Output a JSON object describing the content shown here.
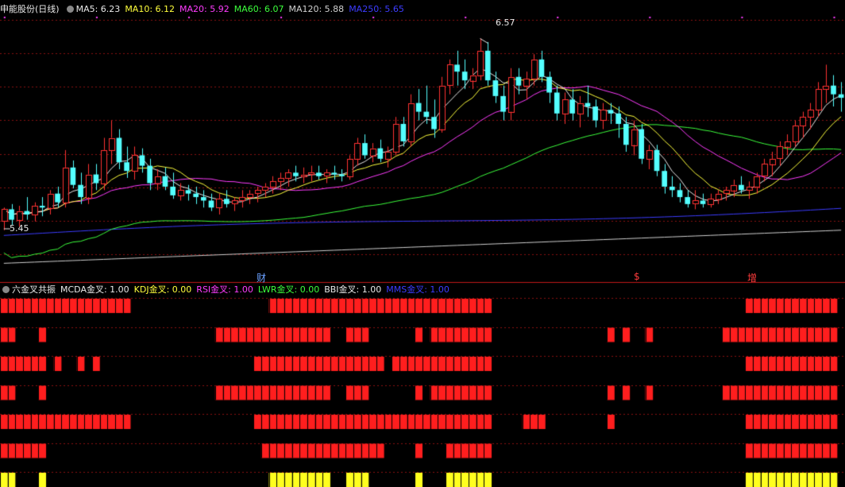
{
  "top_panel": {
    "title": "申能股份(日线)",
    "indicators": [
      {
        "label": "MA5: 6.23",
        "color": "#e8e8e8"
      },
      {
        "label": "MA10: 6.12",
        "color": "#ffff3c"
      },
      {
        "label": "MA20: 5.92",
        "color": "#ff3cff"
      },
      {
        "label": "MA60: 6.07",
        "color": "#3cff3c"
      },
      {
        "label": "MA120: 5.88",
        "color": "#d0d0d0"
      },
      {
        "label": "MA250: 5.65",
        "color": "#3c3cff"
      }
    ],
    "high_label": "6.57",
    "low_label": "5.45",
    "event_markers": [
      {
        "label": "财",
        "color": "#6aa0ff"
      },
      {
        "label": "$",
        "color": "#ff3c3c"
      },
      {
        "label": "增",
        "color": "#ff3c3c"
      }
    ]
  },
  "bottom_panel": {
    "title": "六金叉共振",
    "indicators": [
      {
        "label": "MCDA金叉: 1.00",
        "color": "#e8e8e8"
      },
      {
        "label": "KDJ金叉: 0.00",
        "color": "#ffff3c"
      },
      {
        "label": "RSI金叉: 1.00",
        "color": "#ff3cff"
      },
      {
        "label": "LWR金叉: 0.00",
        "color": "#3cff3c"
      },
      {
        "label": "BBI金叉: 1.00",
        "color": "#e8e8e8"
      },
      {
        "label": "MMS金叉: 1.00",
        "color": "#3c3cff"
      }
    ]
  },
  "chart_data": {
    "type": "candlestick",
    "price_range": [
      5.25,
      6.7
    ],
    "bars": 110,
    "candles": [
      [
        5.52,
        5.6,
        5.47,
        5.59
      ],
      [
        5.59,
        5.62,
        5.5,
        5.53
      ],
      [
        5.53,
        5.61,
        5.49,
        5.58
      ],
      [
        5.58,
        5.66,
        5.53,
        5.56
      ],
      [
        5.56,
        5.63,
        5.52,
        5.61
      ],
      [
        5.61,
        5.66,
        5.55,
        5.6
      ],
      [
        5.6,
        5.7,
        5.56,
        5.68
      ],
      [
        5.68,
        5.72,
        5.6,
        5.63
      ],
      [
        5.63,
        5.93,
        5.6,
        5.83
      ],
      [
        5.83,
        5.87,
        5.71,
        5.73
      ],
      [
        5.73,
        5.8,
        5.62,
        5.66
      ],
      [
        5.66,
        5.85,
        5.62,
        5.79
      ],
      [
        5.79,
        5.85,
        5.7,
        5.74
      ],
      [
        5.74,
        6.0,
        5.7,
        5.93
      ],
      [
        5.93,
        6.1,
        5.85,
        6.0
      ],
      [
        6.0,
        6.05,
        5.82,
        5.86
      ],
      [
        5.86,
        5.95,
        5.77,
        5.81
      ],
      [
        5.81,
        5.95,
        5.76,
        5.9
      ],
      [
        5.9,
        5.94,
        5.8,
        5.84
      ],
      [
        5.84,
        5.88,
        5.7,
        5.74
      ],
      [
        5.74,
        5.82,
        5.7,
        5.78
      ],
      [
        5.78,
        5.83,
        5.7,
        5.72
      ],
      [
        5.72,
        5.8,
        5.65,
        5.67
      ],
      [
        5.67,
        5.74,
        5.64,
        5.7
      ],
      [
        5.7,
        5.73,
        5.64,
        5.68
      ],
      [
        5.68,
        5.72,
        5.62,
        5.66
      ],
      [
        5.66,
        5.7,
        5.6,
        5.64
      ],
      [
        5.64,
        5.68,
        5.58,
        5.6
      ],
      [
        5.6,
        5.68,
        5.56,
        5.65
      ],
      [
        5.65,
        5.7,
        5.6,
        5.62
      ],
      [
        5.62,
        5.66,
        5.58,
        5.64
      ],
      [
        5.64,
        5.7,
        5.6,
        5.66
      ],
      [
        5.66,
        5.7,
        5.62,
        5.68
      ],
      [
        5.68,
        5.72,
        5.63,
        5.7
      ],
      [
        5.7,
        5.74,
        5.66,
        5.72
      ],
      [
        5.72,
        5.78,
        5.68,
        5.75
      ],
      [
        5.75,
        5.8,
        5.7,
        5.77
      ],
      [
        5.77,
        5.82,
        5.72,
        5.8
      ],
      [
        5.8,
        5.84,
        5.75,
        5.78
      ],
      [
        5.78,
        5.83,
        5.74,
        5.79
      ],
      [
        5.79,
        5.84,
        5.75,
        5.8
      ],
      [
        5.8,
        5.84,
        5.76,
        5.78
      ],
      [
        5.78,
        5.82,
        5.74,
        5.8
      ],
      [
        5.8,
        5.84,
        5.76,
        5.79
      ],
      [
        5.79,
        5.82,
        5.75,
        5.78
      ],
      [
        5.78,
        5.9,
        5.76,
        5.88
      ],
      [
        5.88,
        6.0,
        5.84,
        5.97
      ],
      [
        5.97,
        6.02,
        5.88,
        5.9
      ],
      [
        5.9,
        5.97,
        5.86,
        5.94
      ],
      [
        5.94,
        5.99,
        5.86,
        5.88
      ],
      [
        5.88,
        5.95,
        5.83,
        5.92
      ],
      [
        5.92,
        6.12,
        5.9,
        6.08
      ],
      [
        6.08,
        6.12,
        5.95,
        5.98
      ],
      [
        5.98,
        6.25,
        5.95,
        6.2
      ],
      [
        6.2,
        6.28,
        6.1,
        6.15
      ],
      [
        6.15,
        6.3,
        6.08,
        6.12
      ],
      [
        6.12,
        6.22,
        6.0,
        6.05
      ],
      [
        6.05,
        6.35,
        6.03,
        6.3
      ],
      [
        6.3,
        6.45,
        6.25,
        6.42
      ],
      [
        6.42,
        6.5,
        6.3,
        6.38
      ],
      [
        6.38,
        6.45,
        6.28,
        6.33
      ],
      [
        6.33,
        6.4,
        6.28,
        6.36
      ],
      [
        6.36,
        6.57,
        6.33,
        6.5
      ],
      [
        6.5,
        6.55,
        6.3,
        6.33
      ],
      [
        6.33,
        6.38,
        6.2,
        6.24
      ],
      [
        6.24,
        6.3,
        6.1,
        6.15
      ],
      [
        6.15,
        6.4,
        6.1,
        6.35
      ],
      [
        6.35,
        6.4,
        6.25,
        6.3
      ],
      [
        6.3,
        6.38,
        6.22,
        6.34
      ],
      [
        6.34,
        6.48,
        6.3,
        6.45
      ],
      [
        6.45,
        6.5,
        6.32,
        6.35
      ],
      [
        6.35,
        6.38,
        6.2,
        6.26
      ],
      [
        6.26,
        6.3,
        6.1,
        6.14
      ],
      [
        6.14,
        6.26,
        6.08,
        6.22
      ],
      [
        6.22,
        6.28,
        6.1,
        6.14
      ],
      [
        6.14,
        6.24,
        6.06,
        6.2
      ],
      [
        6.2,
        6.3,
        6.12,
        6.18
      ],
      [
        6.18,
        6.22,
        6.06,
        6.1
      ],
      [
        6.1,
        6.2,
        6.05,
        6.16
      ],
      [
        6.16,
        6.2,
        6.08,
        6.14
      ],
      [
        6.14,
        6.18,
        6.0,
        6.08
      ],
      [
        6.08,
        6.12,
        5.92,
        5.96
      ],
      [
        5.96,
        6.1,
        5.9,
        6.05
      ],
      [
        6.05,
        6.08,
        5.85,
        5.88
      ],
      [
        5.88,
        5.96,
        5.82,
        5.93
      ],
      [
        5.93,
        5.96,
        5.78,
        5.81
      ],
      [
        5.81,
        5.85,
        5.68,
        5.72
      ],
      [
        5.72,
        5.78,
        5.66,
        5.7
      ],
      [
        5.7,
        5.74,
        5.63,
        5.66
      ],
      [
        5.66,
        5.7,
        5.6,
        5.62
      ],
      [
        5.62,
        5.7,
        5.59,
        5.64
      ],
      [
        5.64,
        5.68,
        5.6,
        5.62
      ],
      [
        5.62,
        5.68,
        5.6,
        5.65
      ],
      [
        5.65,
        5.7,
        5.62,
        5.68
      ],
      [
        5.68,
        5.72,
        5.64,
        5.7
      ],
      [
        5.7,
        5.76,
        5.66,
        5.73
      ],
      [
        5.73,
        5.78,
        5.68,
        5.7
      ],
      [
        5.7,
        5.75,
        5.65,
        5.72
      ],
      [
        5.72,
        5.8,
        5.68,
        5.78
      ],
      [
        5.78,
        5.88,
        5.75,
        5.85
      ],
      [
        5.85,
        5.92,
        5.78,
        5.88
      ],
      [
        5.88,
        5.98,
        5.84,
        5.95
      ],
      [
        5.95,
        6.02,
        5.9,
        5.98
      ],
      [
        5.98,
        6.1,
        5.95,
        6.07
      ],
      [
        6.07,
        6.15,
        6.0,
        6.12
      ],
      [
        6.12,
        6.2,
        6.05,
        6.16
      ],
      [
        6.16,
        6.32,
        6.12,
        6.28
      ],
      [
        6.28,
        6.42,
        6.2,
        6.3
      ],
      [
        6.3,
        6.36,
        6.18,
        6.25
      ],
      [
        6.25,
        6.32,
        6.15,
        6.23
      ]
    ],
    "band_rows": [
      {
        "color": "#ff1e1e",
        "ranges": [
          [
            0,
            16
          ],
          [
            35,
            63
          ],
          [
            97,
            108
          ]
        ]
      },
      {
        "color": "#ff1e1e",
        "ranges": [
          [
            0,
            1
          ],
          [
            5,
            5
          ],
          [
            28,
            42
          ],
          [
            45,
            47
          ],
          [
            54,
            54
          ],
          [
            56,
            63
          ],
          [
            79,
            79
          ],
          [
            81,
            81
          ],
          [
            84,
            84
          ],
          [
            94,
            108
          ]
        ]
      },
      {
        "color": "#ff1e1e",
        "ranges": [
          [
            0,
            5
          ],
          [
            7,
            7
          ],
          [
            10,
            10
          ],
          [
            12,
            12
          ],
          [
            33,
            49
          ],
          [
            51,
            63
          ],
          [
            97,
            108
          ]
        ]
      },
      {
        "color": "#ff1e1e",
        "ranges": [
          [
            0,
            1
          ],
          [
            5,
            5
          ],
          [
            28,
            42
          ],
          [
            45,
            47
          ],
          [
            54,
            54
          ],
          [
            56,
            63
          ],
          [
            79,
            79
          ],
          [
            81,
            81
          ],
          [
            84,
            84
          ],
          [
            94,
            108
          ]
        ]
      },
      {
        "color": "#ff1e1e",
        "ranges": [
          [
            0,
            16
          ],
          [
            33,
            63
          ],
          [
            68,
            70
          ],
          [
            79,
            79
          ],
          [
            97,
            108
          ]
        ]
      },
      {
        "color": "#ff1e1e",
        "ranges": [
          [
            0,
            5
          ],
          [
            34,
            49
          ],
          [
            54,
            54
          ],
          [
            58,
            63
          ],
          [
            97,
            108
          ]
        ]
      },
      {
        "color": "#ffff1e",
        "ranges": [
          [
            0,
            1
          ],
          [
            5,
            5
          ],
          [
            35,
            42
          ],
          [
            45,
            47
          ],
          [
            54,
            54
          ],
          [
            58,
            63
          ],
          [
            97,
            108
          ]
        ]
      }
    ]
  }
}
